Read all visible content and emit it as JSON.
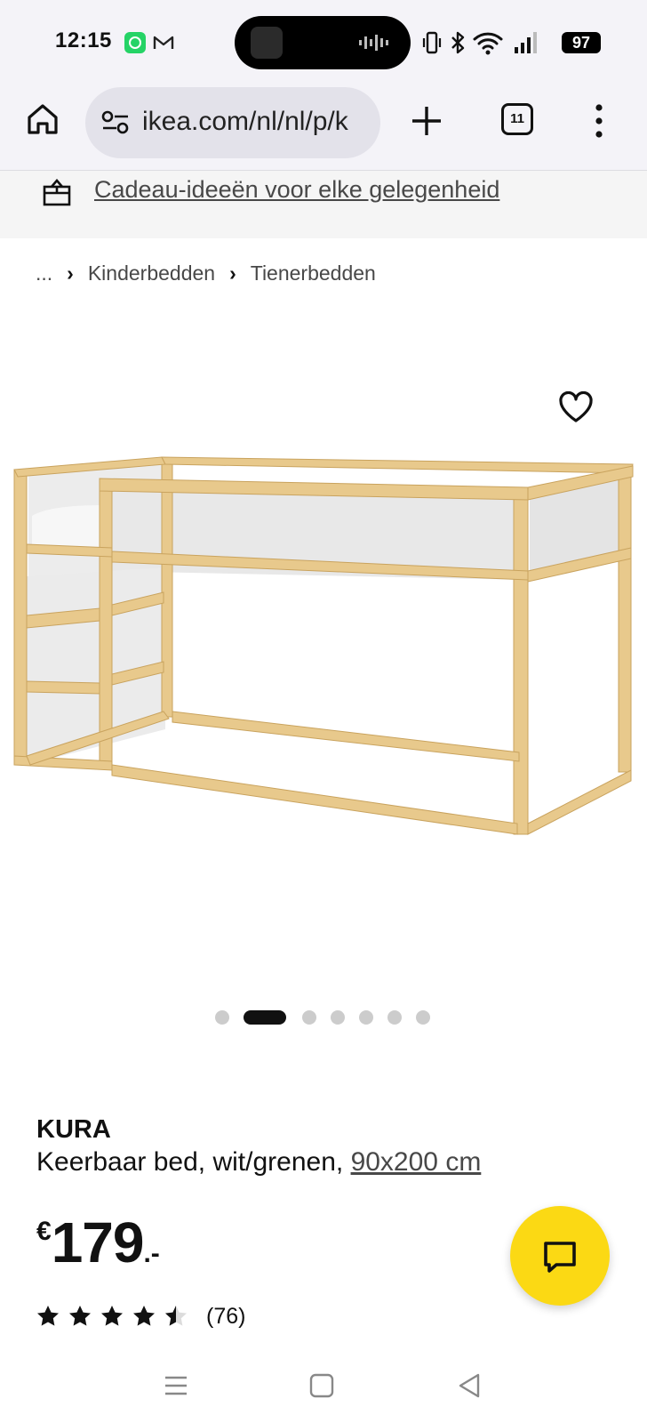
{
  "status_bar": {
    "time": "12:15",
    "battery": "97"
  },
  "browser": {
    "url": "ikea.com/nl/nl/p/k",
    "tab_count": "11"
  },
  "promo": {
    "text": "Cadeau-ideeën voor elke gelegenheid"
  },
  "breadcrumb": {
    "ellipsis": "...",
    "items": [
      "Kinderbedden",
      "Tienerbedden"
    ]
  },
  "carousel": {
    "total": 7,
    "active_index": 1
  },
  "product": {
    "name": "KURA",
    "description": "Keerbaar bed, wit/grenen, ",
    "size": "90x200 cm",
    "price_currency": "€",
    "price_integer": "179",
    "price_decimal": ".-",
    "rating": 4.5,
    "review_count": "(76)"
  },
  "colors": {
    "accent_yellow": "#fbd914",
    "text_dark": "#111111",
    "text_muted": "#484848",
    "wood": "#e8c98c",
    "panel": "#e6e6e6"
  }
}
